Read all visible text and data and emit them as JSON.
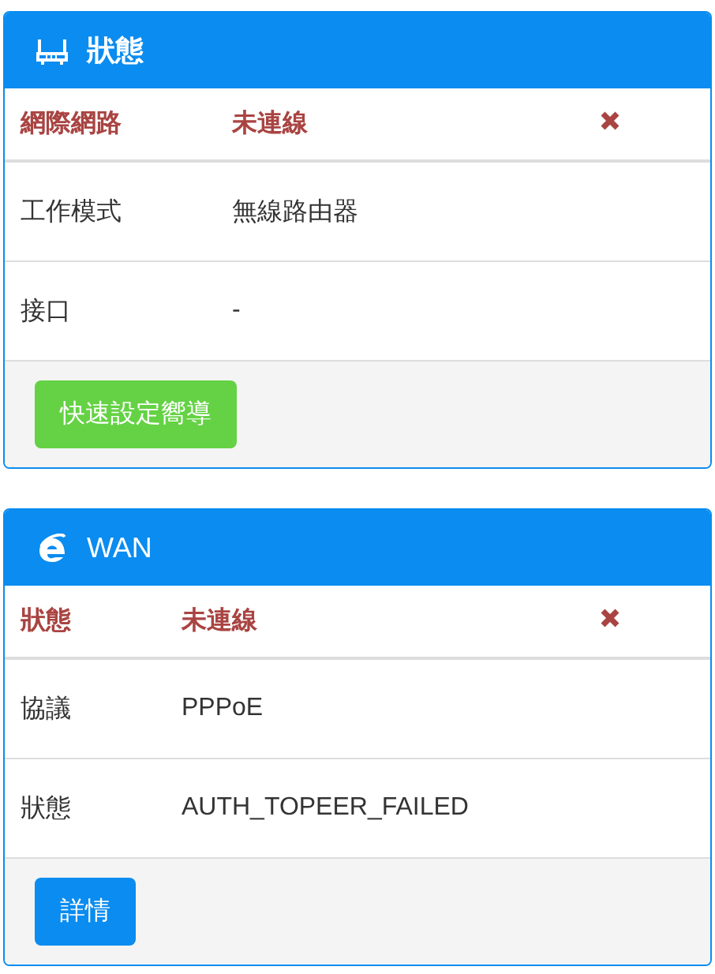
{
  "panels": [
    {
      "kind": "router",
      "title": "狀態",
      "status": {
        "label": "網際網路",
        "value": "未連線",
        "connected": false
      },
      "rows": [
        {
          "label": "工作模式",
          "value": "無線路由器"
        },
        {
          "label": "接口",
          "value": "-"
        }
      ],
      "button": {
        "label": "快速設定嚮導",
        "kind": "success"
      }
    },
    {
      "kind": "wan",
      "title": "WAN",
      "status": {
        "label": "狀態",
        "value": "未連線",
        "connected": false
      },
      "rows": [
        {
          "label": "協議",
          "value": "PPPoE"
        },
        {
          "label": "狀態",
          "value": "AUTH_TOPEER_FAILED"
        }
      ],
      "button": {
        "label": "詳情",
        "kind": "primary"
      }
    }
  ]
}
